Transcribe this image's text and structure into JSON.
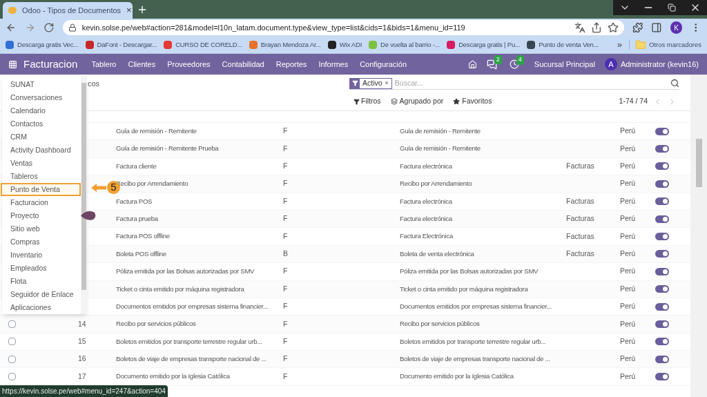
{
  "browser": {
    "tab": {
      "title": "Odoo - Tipos de Documentos",
      "close": "×"
    },
    "url": "kevin.solse.pe/web#action=281&model=l10n_latam.document.type&view_type=list&cids=1&bids=1&menu_id=119",
    "profile": "K",
    "bookmarks": [
      {
        "label": "Descarga gratis Vec...",
        "color": "#2f6fd6"
      },
      {
        "label": "DaFont - Descargar...",
        "color": "#c62828"
      },
      {
        "label": "CURSO DE CORELD...",
        "color": "#e53935"
      },
      {
        "label": "Brayan Mendoza Ar...",
        "color": "#e8712c"
      },
      {
        "label": "Wix ADI",
        "color": "#222222"
      },
      {
        "label": "De vuelta al barrio -...",
        "color": "#7cc242"
      },
      {
        "label": "Descarga gratis | Pu...",
        "color": "#d81b60"
      },
      {
        "label": "Punto de venta Ven...",
        "color": "#37474f"
      }
    ],
    "more_bookmarks": "»",
    "other_bookmarks": "Otros marcadores"
  },
  "navbar": {
    "app": "Facturacion",
    "menu": [
      "Tablero",
      "Clientes",
      "Proveedores",
      "Contabilidad",
      "Reportes",
      "Informes",
      "Configuración"
    ],
    "messages_badge": "2",
    "activities_badge": "4",
    "company": "Sucursal Principal",
    "avatar": "A",
    "user": "Administrator (kevin16)"
  },
  "control_panel": {
    "breadcrumb": "cos",
    "facet": "Activo",
    "facet_remove": "×",
    "search_placeholder": "Buscar...",
    "filters": "Filtros",
    "group_by": "Agrupado por",
    "favorites": "Favoritos",
    "pager": "1-74 / 74"
  },
  "apps_menu": [
    {
      "label": "SUNAT",
      "selected": false
    },
    {
      "label": "Conversaciones",
      "selected": false
    },
    {
      "label": "Calendario",
      "selected": false
    },
    {
      "label": "Contactos",
      "selected": false
    },
    {
      "label": "CRM",
      "selected": false
    },
    {
      "label": "Activity Dashboard",
      "selected": false
    },
    {
      "label": "Ventas",
      "selected": false
    },
    {
      "label": "Tableros",
      "selected": false
    },
    {
      "label": "Punto de Venta",
      "selected": true
    },
    {
      "label": "Facturacion",
      "selected": false
    },
    {
      "label": "Proyecto",
      "selected": false
    },
    {
      "label": "Sitio web",
      "selected": false
    },
    {
      "label": "Compras",
      "selected": false
    },
    {
      "label": "Inventario",
      "selected": false
    },
    {
      "label": "Empleados",
      "selected": false
    },
    {
      "label": "Flota",
      "selected": false
    },
    {
      "label": "Seguidor de Enlace",
      "selected": false
    },
    {
      "label": "Aplicaciones",
      "selected": false
    }
  ],
  "annotation": {
    "number": "5"
  },
  "rows": [
    {
      "name": "Guía de remisión - Remitente",
      "letter": "F",
      "report_name": "Guía de remisión - Remitente",
      "country": "Perú",
      "active": true
    },
    {
      "name": "Guía de remisión - Remitente Prueba",
      "letter": "F",
      "report_name": "Guía de remisión - Remitente",
      "country": "Perú",
      "active": true
    },
    {
      "name": "Factura cliente",
      "letter": "F",
      "report_name": "Factura electrónica",
      "journal": "Facturas",
      "country": "Perú",
      "active": true
    },
    {
      "name": "Recibo por Arrendamiento",
      "letter": "F",
      "report_name": "Recibo por Arrendamiento",
      "country": "Perú",
      "active": true
    },
    {
      "name": "Factura POS",
      "letter": "F",
      "report_name": "Factura electrónica",
      "journal": "Facturas",
      "country": "Perú",
      "active": true
    },
    {
      "name": "Factura prueba",
      "letter": "F",
      "report_name": "Factura electrónica",
      "journal": "Facturas",
      "country": "Perú",
      "active": true
    },
    {
      "name": "Factura POS offline",
      "letter": "F",
      "report_name": "Factura Electrónica",
      "journal": "Facturas",
      "country": "Perú",
      "active": true
    },
    {
      "name": "Boleta POS offline",
      "letter": "B",
      "report_name": "Boleta de venta electrónica",
      "journal": "Facturas",
      "country": "Perú",
      "active": true
    },
    {
      "name": "Póliza emitida por las Bolsas autorizadas por SMV",
      "letter": "F",
      "report_name": "Póliza emitida por las Bolsas autorizadas por SMV",
      "country": "Perú",
      "active": true
    },
    {
      "name": "Ticket o cinta emitido por máquina registradora",
      "letter": "F",
      "report_name": "Ticket o cinta emitido por máquina registradora",
      "country": "Perú",
      "active": true
    },
    {
      "name": "Documentos emitidos por empresas sistema financier...",
      "letter": "F",
      "report_name": "Documentos emitidos por empresas sistema financier...",
      "country": "Perú",
      "active": true
    },
    {
      "checked": false,
      "number": "14",
      "name": "Recibo por servicios públicos",
      "letter": "F",
      "report_name": "Recibo por servicios públicos",
      "country": "Perú",
      "active": true
    },
    {
      "checked": false,
      "number": "15",
      "name": "Boletos emitidos por transporte terrestre regular urb...",
      "letter": "F",
      "report_name": "Boletos emitidos por transporte terrestre regular urb...",
      "country": "Perú",
      "active": true
    },
    {
      "checked": false,
      "number": "16",
      "name": "Boletos de viaje de empresas transporte nacional de ...",
      "letter": "F",
      "report_name": "Boletos de viaje de empresas transporte nacional de ...",
      "country": "Perú",
      "active": true
    },
    {
      "checked": false,
      "number": "17",
      "name": "Documento emitido por la Iglesia Católica",
      "letter": "F",
      "report_name": "Documento emitido por la Iglesia Católica",
      "country": "Perú",
      "active": true
    }
  ],
  "status_url": "https://kevin.solse.pe/web#menu_id=247&action=404"
}
